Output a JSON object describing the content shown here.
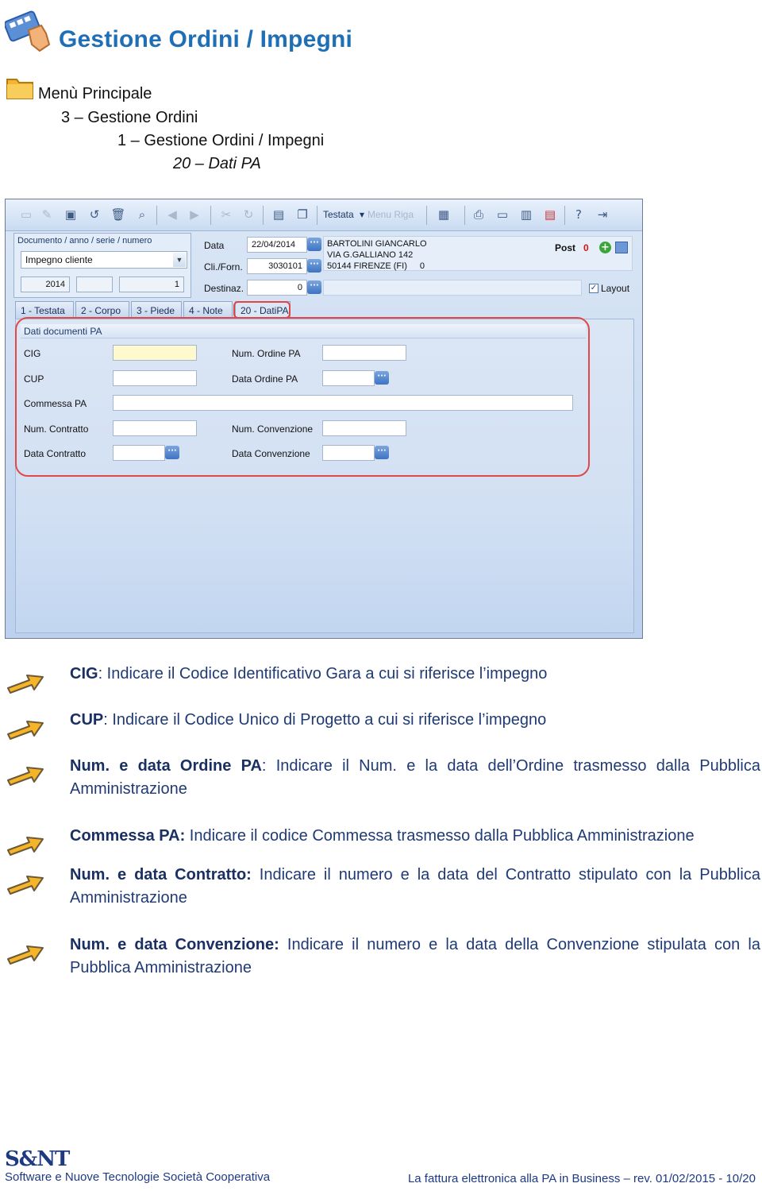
{
  "header": {
    "title": "Gestione Ordini / Impegni",
    "menu_path": [
      "Menù Principale",
      "3 – Gestione Ordini",
      "1 – Gestione Ordini / Impegni",
      "20 – Dati PA"
    ]
  },
  "app": {
    "toolbar": {
      "testata_label": "Testata",
      "menu_riga_label": "Menu Riga"
    },
    "document": {
      "section_label": "Documento / anno / serie / numero",
      "doc_type": "Impegno cliente",
      "year": "2014",
      "series": "",
      "number": "1"
    },
    "header_fields": {
      "data_label": "Data",
      "data_value": "22/04/2014",
      "cliforn_label": "Cli./Forn.",
      "cliforn_value": "3030101",
      "destinaz_label": "Destinaz.",
      "destinaz_value": "0",
      "customer_name": "BARTOLINI GIANCARLO",
      "customer_address": "VIA G.GALLIANO 142",
      "customer_city": "50144 FIRENZE (FI)",
      "customer_extra": "0",
      "post_label": "Post",
      "post_value": "0",
      "layout_label": "Layout",
      "layout_checked": true
    },
    "tabs": [
      "1 - Testata",
      "2 - Corpo",
      "3 - Piede",
      "4 - Note",
      "20 - DatiPA"
    ],
    "active_tab": "20 - DatiPA",
    "panel": {
      "title": "Dati documenti PA",
      "labels": {
        "cig": "CIG",
        "cup": "CUP",
        "commessa": "Commessa PA",
        "num_contratto": "Num. Contratto",
        "data_contratto": "Data Contratto",
        "num_ordine": "Num. Ordine PA",
        "data_ordine": "Data Ordine PA",
        "num_convenzione": "Num. Convenzione",
        "data_convenzione": "Data Convenzione"
      }
    }
  },
  "descriptions": [
    {
      "term": "CIG",
      "sep": ":",
      "text": " Indicare il  Codice Identificativo Gara a cui si riferisce l’impegno"
    },
    {
      "term": "CUP",
      "sep": ":",
      "text": " Indicare il Codice Unico di Progetto a cui si riferisce l’impegno"
    },
    {
      "term": "Num. e data Ordine PA",
      "sep": ":",
      "text": " Indicare il Num. e la data dell’Ordine trasmesso dalla Pubblica Amministrazione"
    },
    {
      "term": "Commessa PA:",
      "sep": "",
      "text": " Indicare il codice Commessa trasmesso dalla Pubblica Amministrazione"
    },
    {
      "term": "Num. e data Contratto:",
      "sep": "",
      "text": " Indicare il numero e la data del Contratto stipulato con la Pubblica Amministrazione"
    },
    {
      "term": "Num. e data Convenzione:",
      "sep": "",
      "text": " Indicare il numero e la data della Convenzione stipulata con la Pubblica Amministrazione"
    }
  ],
  "footer": {
    "logo": "S&NT",
    "company": "Software e Nuove Tecnologie Società Cooperativa",
    "doc_info": "La fattura elettronica alla PA in Business – rev. 01/02/2015 - 10/20"
  },
  "colors": {
    "title": "#1f6fb7",
    "text": "#1f3a74",
    "highlight": "#e14848",
    "cig_field": "#fffacd"
  }
}
